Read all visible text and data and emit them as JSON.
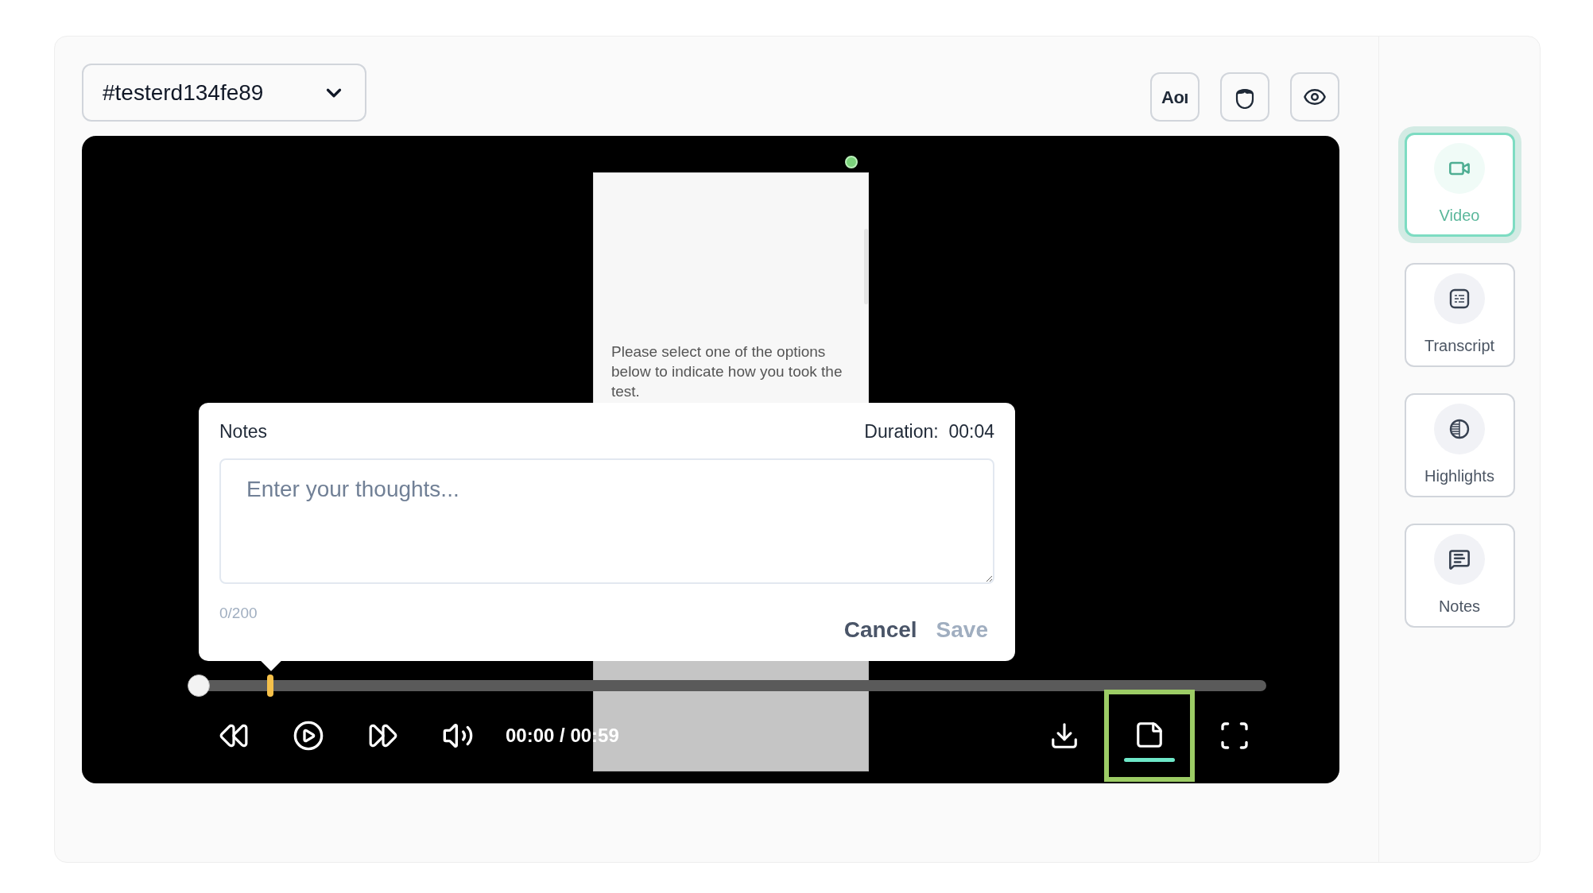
{
  "selector": {
    "value": "#testerd134fe89"
  },
  "toolbar": [
    {
      "kind": "aoi",
      "label": "Aoı"
    },
    {
      "kind": "face"
    },
    {
      "kind": "eye"
    }
  ],
  "video": {
    "frame_text": "Please select one of the options below to indicate how you took the test.",
    "progress": {
      "level": 0
    },
    "time": "00:00 / 00:59",
    "controls": [
      {
        "kind": "rewind",
        "selected": false
      },
      {
        "kind": "play",
        "selected": false
      },
      {
        "kind": "forward",
        "selected": false
      },
      {
        "kind": "volume",
        "selected": false
      },
      {
        "kind": "download",
        "selected": false
      },
      {
        "kind": "note",
        "selected": true
      },
      {
        "kind": "fullscreen",
        "selected": false
      }
    ]
  },
  "notes_popup": {
    "title": "Notes",
    "duration_label": "Duration:",
    "duration": "00:04",
    "placeholder": "Enter your thoughts...",
    "counter": "0/200",
    "buttons": [
      {
        "label": "Cancel",
        "disabled": false
      },
      {
        "label": "Save",
        "disabled": true
      }
    ]
  },
  "sidebar": [
    {
      "kind": "video",
      "label": "Video",
      "selected": true
    },
    {
      "kind": "transcript",
      "label": "Transcript",
      "selected": false
    },
    {
      "kind": "highlights",
      "label": "Highlights",
      "selected": false
    },
    {
      "kind": "notes",
      "label": "Notes",
      "selected": false
    }
  ]
}
